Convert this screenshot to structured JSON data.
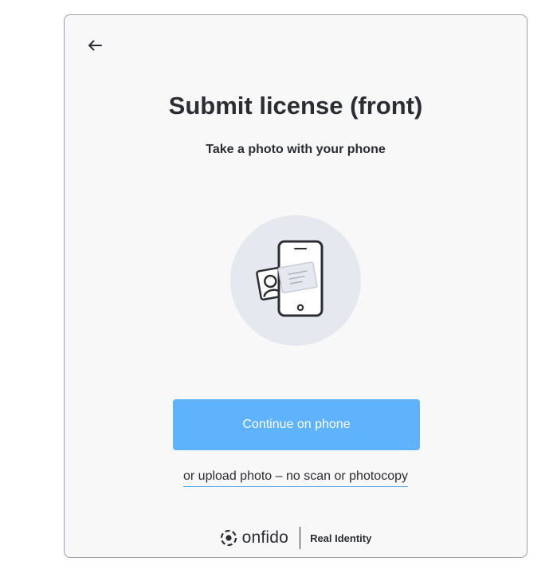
{
  "card": {
    "title": "Submit license (front)",
    "subtitle": "Take a photo with your phone",
    "primary_button_label": "Continue on phone",
    "secondary_link_label": "or upload photo – no scan or photocopy"
  },
  "footer": {
    "brand_name": "onfido",
    "tagline": "Real Identity"
  },
  "icons": {
    "back": "arrow-left-icon",
    "illustration": "phone-with-id-card-icon",
    "logo": "onfido-logo-icon"
  },
  "colors": {
    "accent": "#5eb3fc",
    "text": "#2b2d33",
    "card_background": "#f8f8f9",
    "illustration_background": "#e5e8ee"
  }
}
